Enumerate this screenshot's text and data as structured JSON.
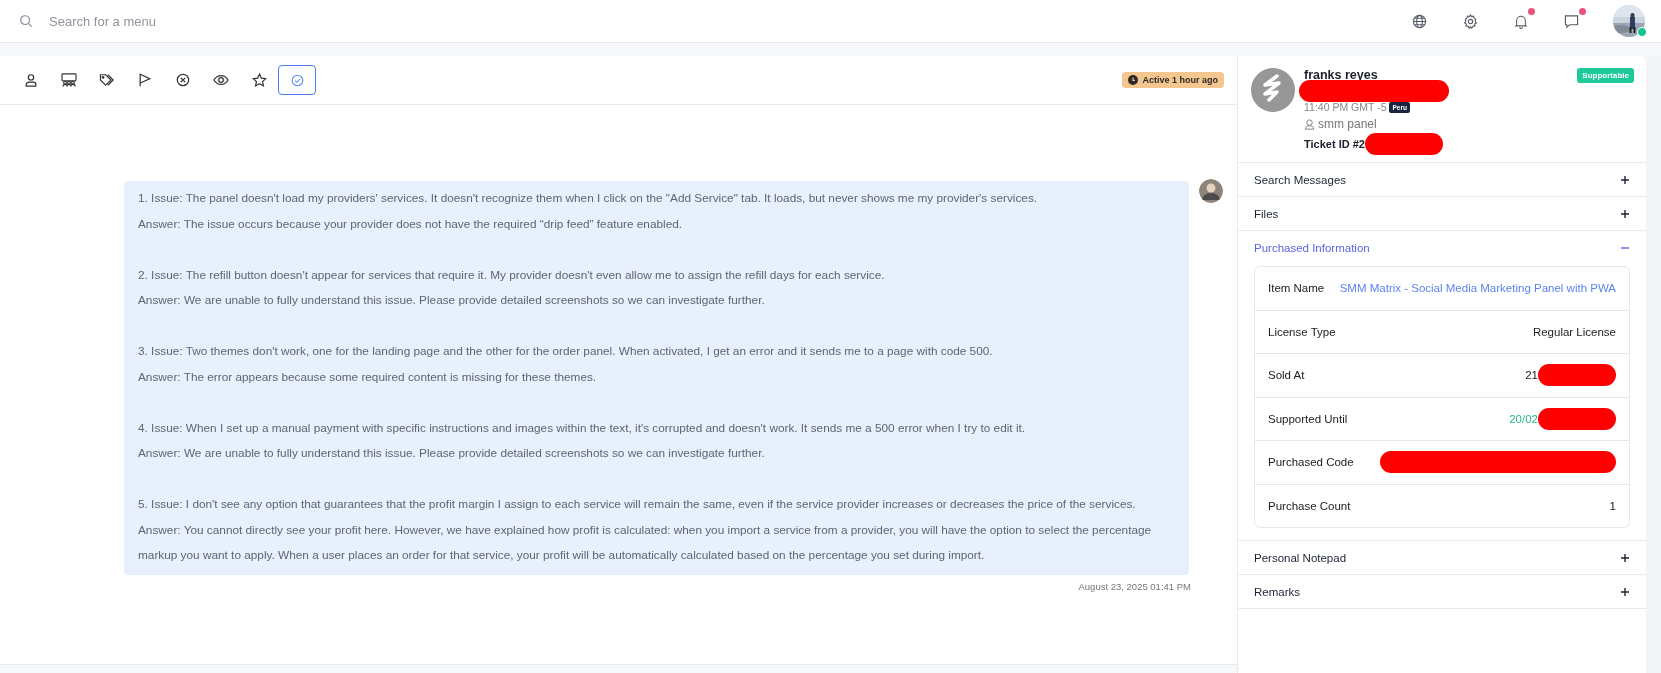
{
  "topbar": {
    "search": {
      "placeholder": "Search for a menu"
    },
    "notifications": [
      {
        "kind": "globe",
        "badge": false
      },
      {
        "kind": "gear",
        "badge": false
      },
      {
        "kind": "bell",
        "badge": true
      },
      {
        "kind": "chat",
        "badge": true
      }
    ],
    "user": {
      "online": true
    }
  },
  "toolbar": {
    "tabs": [
      {
        "kind": "person",
        "selected": false
      },
      {
        "kind": "group",
        "selected": false
      },
      {
        "kind": "tags",
        "selected": false
      },
      {
        "kind": "flag",
        "selected": false
      },
      {
        "kind": "x-circle",
        "selected": false
      },
      {
        "kind": "eye",
        "selected": false
      },
      {
        "kind": "star",
        "selected": false
      },
      {
        "kind": "check-circle",
        "selected": true
      }
    ],
    "status": "Active 1 hour ago"
  },
  "message": {
    "items": [
      {
        "issue": "1. Issue: The panel doesn't load my providers' services. It doesn't recognize them when I click on the \"Add Service\" tab. It loads, but never shows me my provider's services.",
        "answer": "Answer: The issue occurs because your provider does not have the required “drip feed” feature enabled."
      },
      {
        "issue": "2. Issue: The refill button doesn't appear for services that require it. My provider doesn't even allow me to assign the refill days for each service.",
        "answer": "Answer: We are unable to fully understand this issue. Please provide detailed screenshots so we can investigate further."
      },
      {
        "issue": "3. Issue: Two themes don't work, one for the landing page and the other for the order panel. When activated, I get an error and it sends me to a page with code 500.",
        "answer": "Answer: The error appears because some required content is missing for these themes."
      },
      {
        "issue": "4. Issue: When I set up a manual payment with specific instructions and images within the text, it's corrupted and doesn't work. It sends me a 500 error when I try to edit it.",
        "answer": "Answer: We are unable to fully understand this issue. Please provide detailed screenshots so we can investigate further."
      },
      {
        "issue": "5. Issue: I don't see any option that guarantees that the profit margin I assign to each service will remain the same, even if the service provider increases or decreases the price of the services.",
        "answer": "Answer: You cannot directly see your profit here. However, we have explained how profit is calculated: when you import a service from a provider, you will have the option to select the percentage markup you want to apply. When a user places an order for that service, your profit will be automatically calculated based on the percentage you set during import."
      }
    ],
    "timestamp": "August 23, 2025 01:41 PM"
  },
  "profile": {
    "name": "franks reyes",
    "redacted": true,
    "badge": "Supportable",
    "time": "11:40 PM GMT -5",
    "country": "Peru",
    "group": "smm panel",
    "ticket": "Ticket ID #2",
    "ticket_redacted": true
  },
  "sections": [
    {
      "title": "Search Messages",
      "expanded": false
    },
    {
      "title": "Files",
      "expanded": false
    },
    {
      "title": "Purchased Information",
      "expanded": true,
      "rows": [
        {
          "label": "Item Name",
          "value": "SMM Matrix - Social Media Marketing Panel with PWA",
          "kind": "link",
          "redacted": false
        },
        {
          "label": "License Type",
          "value": "Regular License",
          "kind": "plain",
          "redacted": false
        },
        {
          "label": "Sold At",
          "value": "21",
          "kind": "plain",
          "redacted": true
        },
        {
          "label": "Supported Until",
          "value": "20/02",
          "kind": "good",
          "redacted": true
        },
        {
          "label": "Purchased Code",
          "redacted": true
        },
        {
          "label": "Purchase Count",
          "value": "1",
          "kind": "plain",
          "redacted": false
        }
      ]
    },
    {
      "title": "Personal Notepad",
      "expanded": false
    },
    {
      "title": "Remarks",
      "expanded": false
    }
  ]
}
